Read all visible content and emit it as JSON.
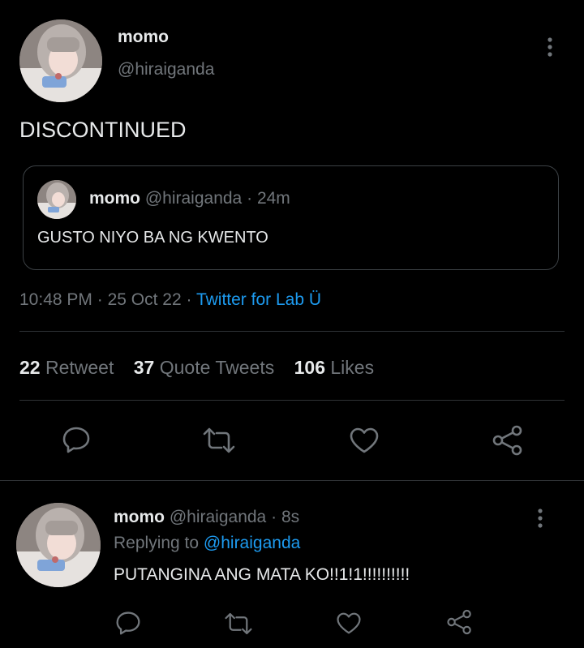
{
  "main_tweet": {
    "display_name": "momo",
    "handle": "@hiraiganda",
    "text": "DISCONTINUED",
    "more_icon": "more-vertical-icon"
  },
  "quoted_tweet": {
    "display_name": "momo",
    "handle": "@hiraiganda",
    "separator": "·",
    "time": "24m",
    "text": "GUSTO NIYO BA NG KWENTO"
  },
  "meta": {
    "time": "10:48 PM",
    "sep1": "·",
    "date": "25 Oct 22",
    "sep2": "·",
    "source": "Twitter for Lab Ü"
  },
  "stats": {
    "retweets_count": "22",
    "retweets_label": "Retweet",
    "quotes_count": "37",
    "quotes_label": "Quote Tweets",
    "likes_count": "106",
    "likes_label": "Likes"
  },
  "actions": [
    "reply-icon",
    "retweet-icon",
    "like-icon",
    "share-icon"
  ],
  "reply_tweet": {
    "display_name": "momo",
    "handle": "@hiraiganda",
    "separator": "·",
    "time": "8s",
    "replying_label": "Replying to",
    "replying_handle": "@hiraiganda",
    "text": "PUTANGINA ANG MATA KO!!1!1!!!!!!!!!!"
  },
  "colors": {
    "background": "#000000",
    "text": "#e7e9ea",
    "muted": "#71767b",
    "accent": "#1d9bf0",
    "border": "#2f3336"
  }
}
